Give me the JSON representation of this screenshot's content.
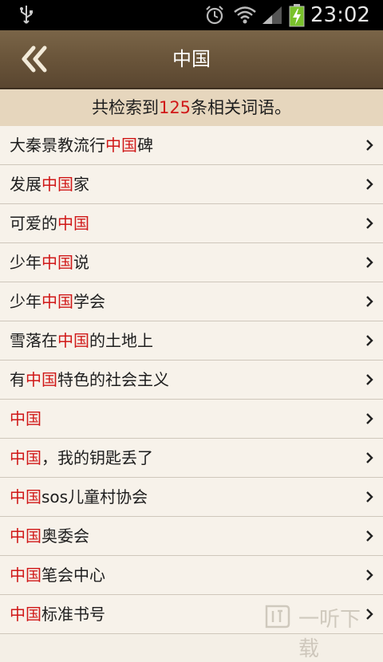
{
  "status_bar": {
    "time": "23:02"
  },
  "header": {
    "title": "中国"
  },
  "summary": {
    "prefix": "共检索到",
    "count": "125",
    "suffix": "条相关词语。"
  },
  "results": [
    {
      "before": "大秦景教流行",
      "match": "中国",
      "after": "碑"
    },
    {
      "before": "发展",
      "match": "中国",
      "after": "家"
    },
    {
      "before": "可爱的",
      "match": "中国",
      "after": ""
    },
    {
      "before": "少年",
      "match": "中国",
      "after": "说"
    },
    {
      "before": "少年",
      "match": "中国",
      "after": "学会"
    },
    {
      "before": "雪落在",
      "match": "中国",
      "after": "的土地上"
    },
    {
      "before": "有",
      "match": "中国",
      "after": "特色的社会主义"
    },
    {
      "before": "",
      "match": "中国",
      "after": ""
    },
    {
      "before": "",
      "match": "中国",
      "after": "，我的钥匙丢了"
    },
    {
      "before": "",
      "match": "中国",
      "after": "sos儿童村协会"
    },
    {
      "before": "",
      "match": "中国",
      "after": "奥委会"
    },
    {
      "before": "",
      "match": "中国",
      "after": "笔会中心"
    },
    {
      "before": "",
      "match": "中国",
      "after": "标准书号"
    }
  ],
  "watermark": {
    "text": "一听下载"
  },
  "colors": {
    "highlight": "#d01818",
    "header": "#6b563b",
    "summary_bg": "#e6d6bd"
  },
  "icons": [
    "usb-icon",
    "alarm-icon",
    "wifi-icon",
    "signal-icon",
    "battery-charging-icon",
    "double-chevron-left-icon",
    "chevron-right-icon"
  ]
}
